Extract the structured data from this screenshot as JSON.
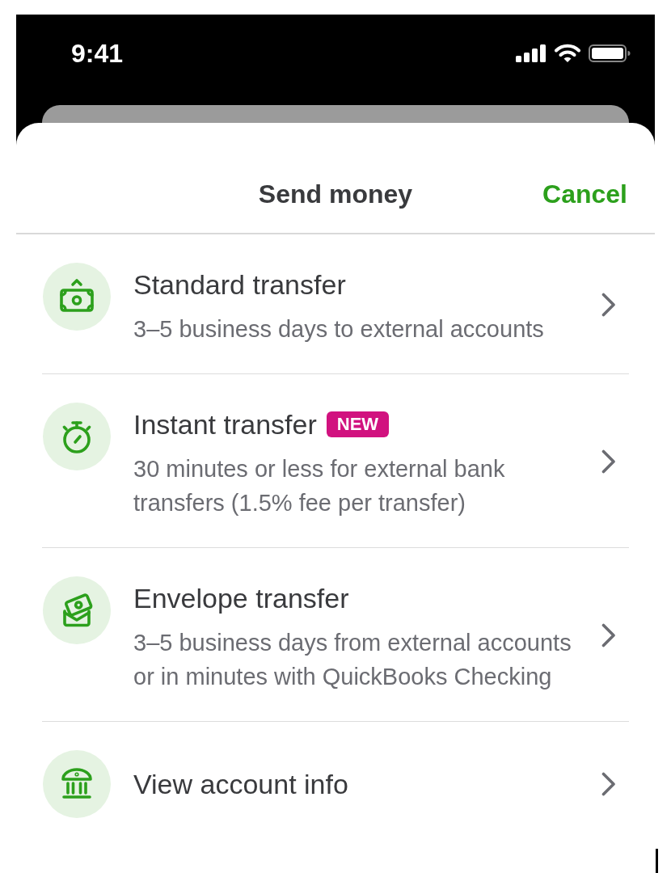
{
  "status_bar": {
    "time": "9:41"
  },
  "sheet": {
    "title": "Send money",
    "cancel": "Cancel"
  },
  "options": [
    {
      "title": "Standard transfer",
      "subtitle_lines": [
        "3–5 business days to external accounts"
      ]
    },
    {
      "title": "Instant transfer",
      "badge": "NEW",
      "subtitle_lines": [
        "30 minutes or less for external bank",
        "transfers (1.5% fee per transfer)"
      ]
    },
    {
      "title": "Envelope transfer",
      "subtitle_lines": [
        "3–5 business days from external accounts",
        "or in minutes with QuickBooks Checking"
      ]
    },
    {
      "title": "View account info"
    }
  ]
}
